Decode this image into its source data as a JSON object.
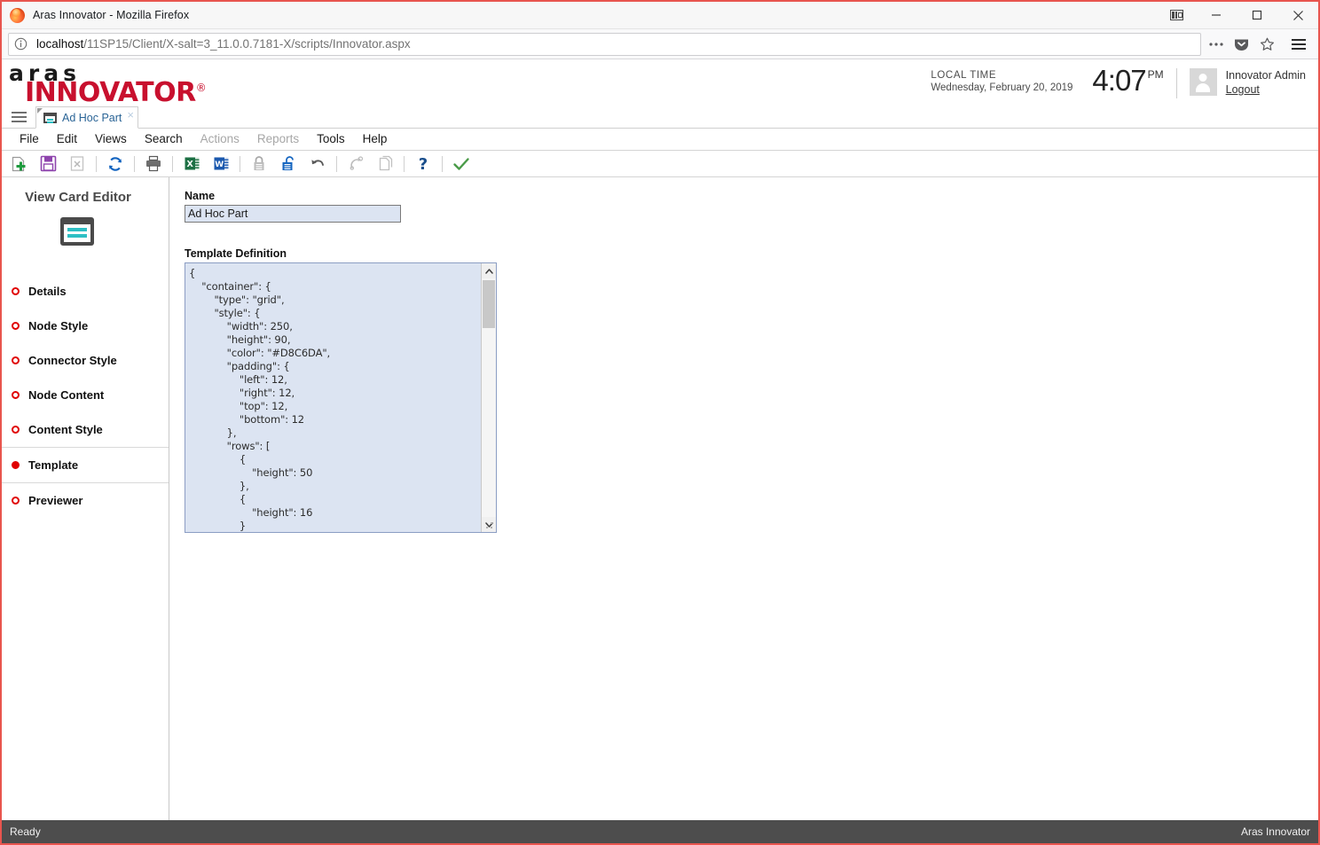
{
  "browser": {
    "window_title": "Aras Innovator - Mozilla Firefox",
    "url_host": "localhost",
    "url_path": "/11SP15/Client/X-salt=3_11.0.0.7181-X/scripts/Innovator.aspx",
    "controls": {
      "sidebar_toggle": "sidebar-toggle-icon",
      "minimize": "minimize-icon",
      "maximize": "maximize-icon",
      "close": "close-icon"
    },
    "urlbar_icons": {
      "info": "info-icon",
      "page_actions": "ellipsis-icon",
      "pocket": "pocket-icon",
      "bookmark": "star-icon",
      "app_menu": "hamburger-icon"
    }
  },
  "header": {
    "brand_line1": "aras",
    "brand_line2": "INNOVATOR",
    "brand_registered": "®",
    "local_time_label": "LOCAL TIME",
    "local_time_date": "Wednesday, February 20, 2019",
    "clock_time": "4:07",
    "clock_ampm": "PM",
    "user_name": "Innovator Admin",
    "logout_label": "Logout",
    "brand_color": "#c8102e"
  },
  "tabs": [
    {
      "label": "Ad Hoc Part",
      "icon": "card-icon",
      "close": "×",
      "active": true
    }
  ],
  "menubar": [
    {
      "label": "File",
      "disabled": false
    },
    {
      "label": "Edit",
      "disabled": false
    },
    {
      "label": "Views",
      "disabled": false
    },
    {
      "label": "Search",
      "disabled": false
    },
    {
      "label": "Actions",
      "disabled": true
    },
    {
      "label": "Reports",
      "disabled": true
    },
    {
      "label": "Tools",
      "disabled": false
    },
    {
      "label": "Help",
      "disabled": false
    }
  ],
  "toolbar": [
    {
      "name": "new-item-button",
      "icon": "new-document-plus-icon",
      "enabled": true
    },
    {
      "name": "save-button",
      "icon": "floppy-save-icon",
      "enabled": true
    },
    {
      "name": "delete-button",
      "icon": "document-x-icon",
      "enabled": false
    },
    {
      "separator": true
    },
    {
      "name": "refresh-button",
      "icon": "refresh-circular-arrows-icon",
      "enabled": true
    },
    {
      "separator": true
    },
    {
      "name": "print-button",
      "icon": "printer-icon",
      "enabled": true
    },
    {
      "separator": true
    },
    {
      "name": "export-excel-button",
      "icon": "excel-icon",
      "enabled": true
    },
    {
      "name": "export-word-button",
      "icon": "word-icon",
      "enabled": true
    },
    {
      "separator": true
    },
    {
      "name": "lock-button",
      "icon": "padlock-closed-icon",
      "enabled": false
    },
    {
      "name": "unlock-button",
      "icon": "padlock-open-icon",
      "enabled": true
    },
    {
      "name": "undo-button",
      "icon": "undo-arrow-icon",
      "enabled": true
    },
    {
      "separator": true
    },
    {
      "name": "redo-button",
      "icon": "redo-arrow-icon",
      "enabled": false
    },
    {
      "name": "copy-button",
      "icon": "copy-pages-icon",
      "enabled": false
    },
    {
      "separator": true
    },
    {
      "name": "help-button",
      "icon": "question-mark-icon",
      "enabled": true
    },
    {
      "separator": true
    },
    {
      "name": "done-button",
      "icon": "checkmark-icon",
      "enabled": true
    }
  ],
  "sidebar": {
    "title": "View Card Editor",
    "icon": "view-card-icon",
    "items": [
      {
        "label": "Details",
        "active": false
      },
      {
        "label": "Node Style",
        "active": false
      },
      {
        "label": "Connector Style",
        "active": false
      },
      {
        "label": "Node Content",
        "active": false
      },
      {
        "label": "Content Style",
        "active": false
      },
      {
        "label": "Template",
        "active": true
      },
      {
        "label": "Previewer",
        "active": false
      }
    ],
    "bullet_color": "#e00000"
  },
  "form": {
    "name_label": "Name",
    "name_value": "Ad Hoc Part",
    "template_label": "Template Definition",
    "template_value": "{\n    \"container\": {\n        \"type\": \"grid\",\n        \"style\": {\n            \"width\": 250,\n            \"height\": 90,\n            \"color\": \"#D8C6DA\",\n            \"padding\": {\n                \"left\": 12,\n                \"right\": 12,\n                \"top\": 12,\n                \"bottom\": 12\n            },\n            \"rows\": [\n                {\n                    \"height\": 50\n                },\n                {\n                    \"height\": 16\n                }"
  },
  "statusbar": {
    "left": "Ready",
    "right": "Aras Innovator"
  }
}
